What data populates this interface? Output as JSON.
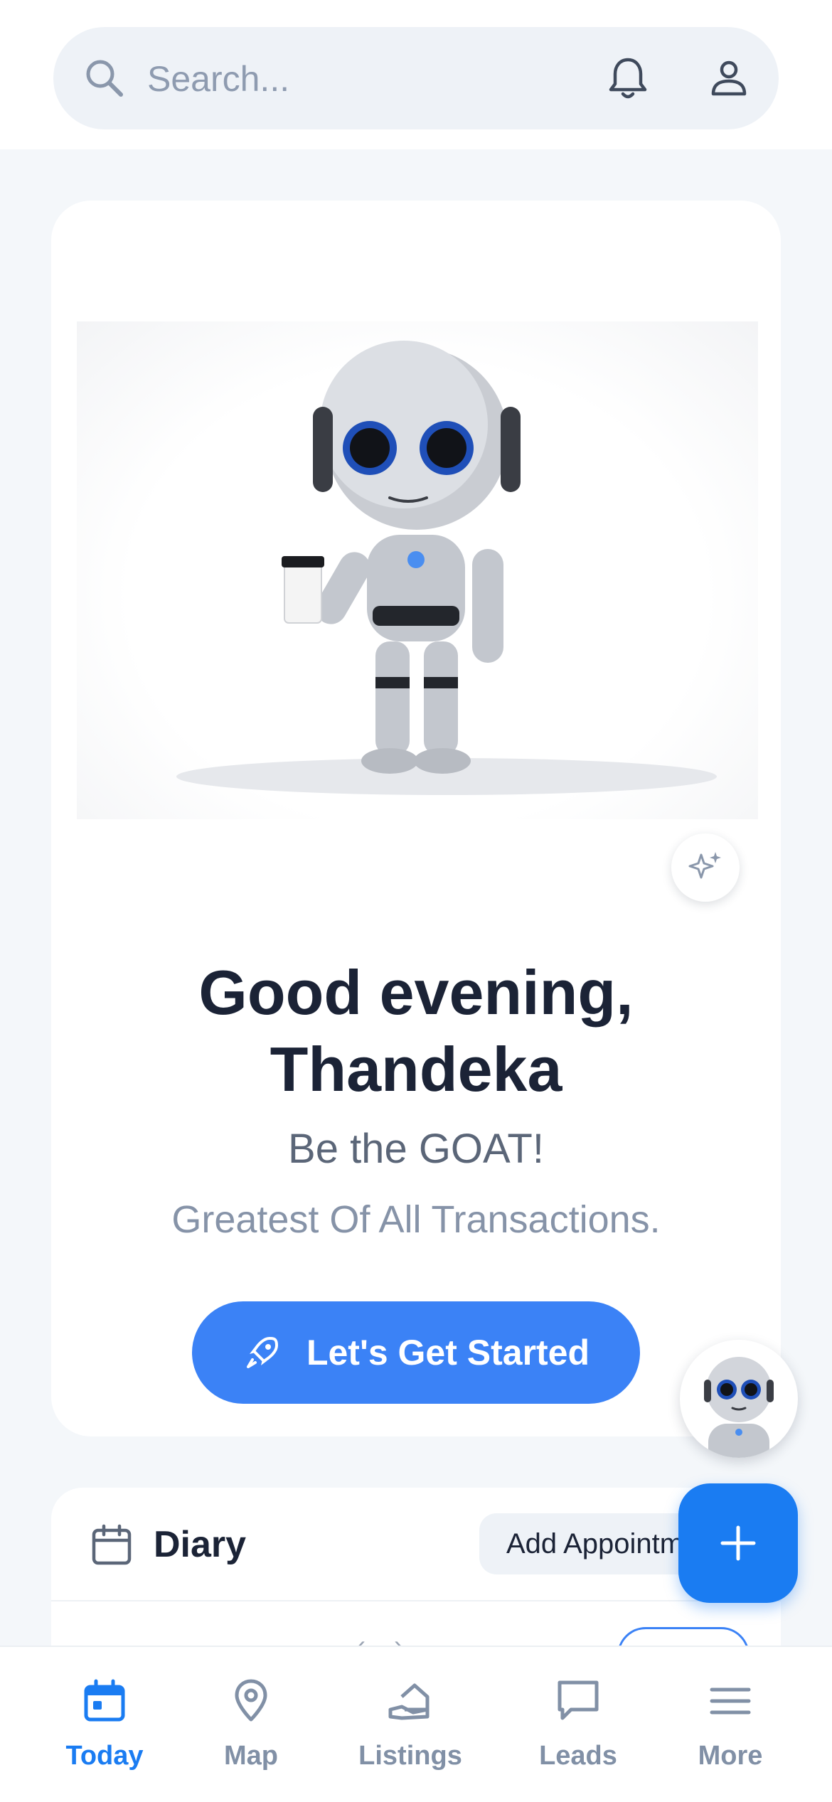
{
  "search": {
    "placeholder": "Search...",
    "icon": "search-icon"
  },
  "header_icons": [
    "bell-icon",
    "user-icon"
  ],
  "hero": {
    "greeting_line1": "Good evening,",
    "greeting_line2": "Thandeka",
    "slogan": "Be the GOAT!",
    "tagline": "Greatest Of All Transactions.",
    "cta_label": "Let's Get Started",
    "cta_icon": "rocket-icon",
    "sparkle_icon": "sparkles-icon"
  },
  "diary": {
    "title": "Diary",
    "add_label": "Add Appointment"
  },
  "nav": [
    {
      "label": "Today",
      "icon": "calendar-icon",
      "active": true
    },
    {
      "label": "Map",
      "icon": "map-pin-icon"
    },
    {
      "label": "Listings",
      "icon": "listings-icon"
    },
    {
      "label": "Leads",
      "icon": "chat-icon"
    },
    {
      "label": "More",
      "icon": "menu-icon"
    }
  ],
  "colors": {
    "accent": "#3b82f6",
    "fab": "#1a7cf2",
    "text_dark": "#1b2336",
    "text_muted": "#8190a6",
    "background": "#f4f7fa"
  }
}
